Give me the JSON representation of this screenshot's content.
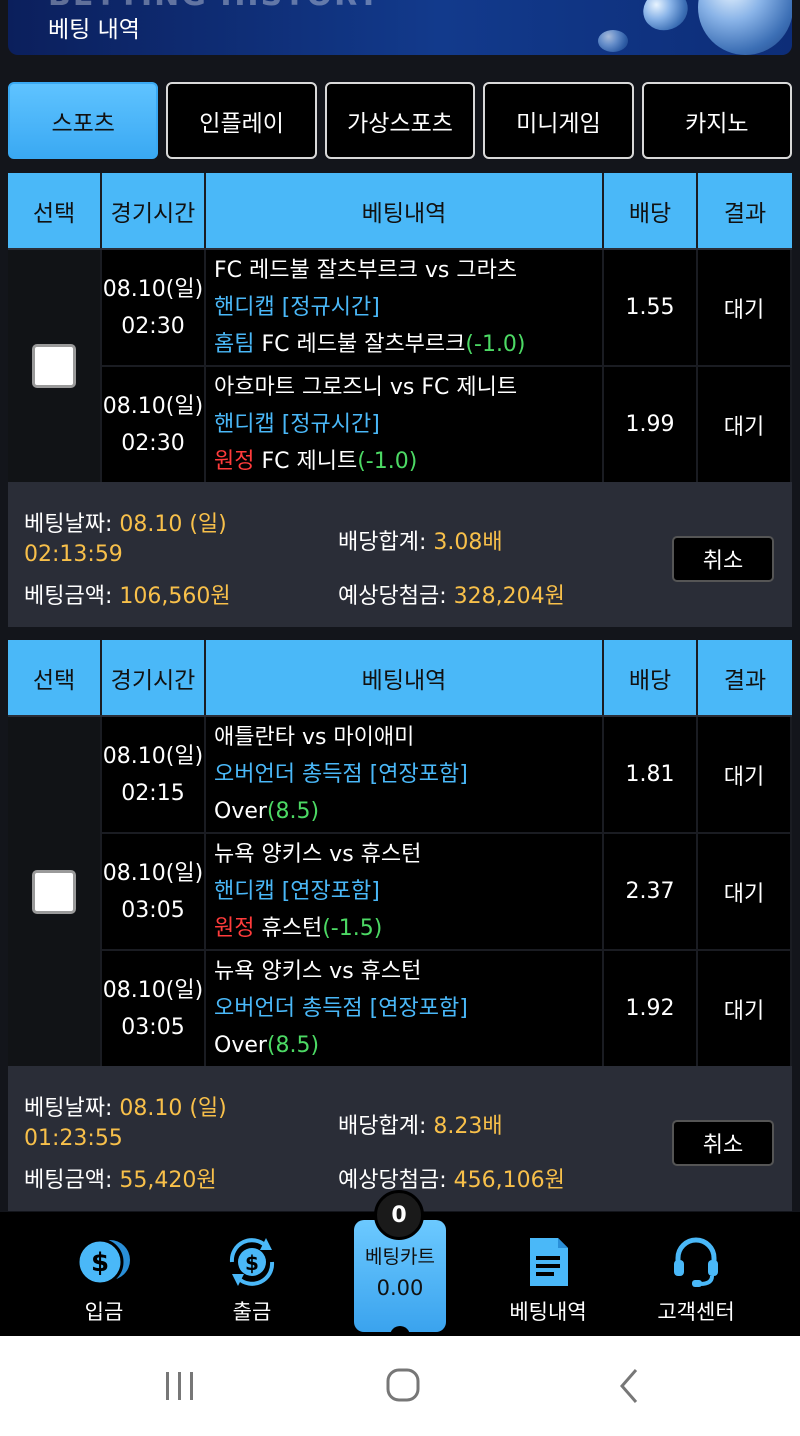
{
  "banner": {
    "title": "베팅 내역",
    "ghost_text": "BETTING HISTORY"
  },
  "tabs": [
    {
      "label": "스포츠",
      "active": true
    },
    {
      "label": "인플레이",
      "active": false
    },
    {
      "label": "가상스포츠",
      "active": false
    },
    {
      "label": "미니게임",
      "active": false
    },
    {
      "label": "카지노",
      "active": false
    }
  ],
  "table_headers": {
    "select": "선택",
    "time": "경기시간",
    "detail": "베팅내역",
    "odds": "배당",
    "result": "결과"
  },
  "bets": [
    {
      "rows": [
        {
          "date": "08.10(일)",
          "time": "02:30",
          "match": "FC 레드불 잘츠부르크 vs 그라츠",
          "market": "핸디캡 [정규시간]",
          "pick_side": "홈팀",
          "pick_team": "FC 레드불 잘츠부르크",
          "pick_line": "(-1.0)",
          "odds": "1.55",
          "result": "대기"
        },
        {
          "date": "08.10(일)",
          "time": "02:30",
          "match": "아흐마트 그로즈니 vs FC 제니트",
          "market": "핸디캡 [정규시간]",
          "pick_side": "원정",
          "pick_team": "FC 제니트",
          "pick_line": "(-1.0)",
          "odds": "1.99",
          "result": "대기"
        }
      ],
      "summary": {
        "bet_date_label": "베팅날짜:",
        "bet_date": "08.10 (일)",
        "bet_time": "02:13:59",
        "amount_label": "베팅금액:",
        "amount": "106,560원",
        "total_odds_label": "배당합계:",
        "total_odds": "3.08배",
        "expected_label": "예상당첨금:",
        "expected": "328,204원",
        "cancel": "취소"
      }
    },
    {
      "rows": [
        {
          "date": "08.10(일)",
          "time": "02:15",
          "match": "애틀란타 vs 마이애미",
          "market": "오버언더 총득점 [연장포함]",
          "pick_side": "",
          "pick_team": "Over",
          "pick_line": "(8.5)",
          "odds": "1.81",
          "result": "대기"
        },
        {
          "date": "08.10(일)",
          "time": "03:05",
          "match": "뉴욕 양키스 vs 휴스턴",
          "market": "핸디캡 [연장포함]",
          "pick_side": "원정",
          "pick_team": "휴스턴",
          "pick_line": "(-1.5)",
          "odds": "2.37",
          "result": "대기"
        },
        {
          "date": "08.10(일)",
          "time": "03:05",
          "match": "뉴욕 양키스 vs 휴스턴",
          "market": "오버언더 총득점 [연장포함]",
          "pick_side": "",
          "pick_team": "Over",
          "pick_line": "(8.5)",
          "odds": "1.92",
          "result": "대기"
        }
      ],
      "summary": {
        "bet_date_label": "베팅날짜:",
        "bet_date": "08.10 (일)",
        "bet_time": "01:23:55",
        "amount_label": "베팅금액:",
        "amount": "55,420원",
        "total_odds_label": "배당합계:",
        "total_odds": "8.23배",
        "expected_label": "예상당첨금:",
        "expected": "456,106원",
        "cancel": "취소"
      }
    }
  ],
  "bottom_nav": {
    "deposit": "입금",
    "withdraw": "출금",
    "cart_title": "베팅카트",
    "cart_value": "0.00",
    "cart_count": "0",
    "history": "베팅내역",
    "support": "고객센터"
  },
  "icons": {
    "deposit": "dollar-coin-icon",
    "withdraw": "dollar-refresh-icon",
    "history": "document-icon",
    "support": "headset-icon"
  },
  "colors": {
    "accent": "#4ab8f8",
    "highlight": "#f8c04a",
    "away": "#ff3b3b",
    "line": "#4cd964"
  }
}
